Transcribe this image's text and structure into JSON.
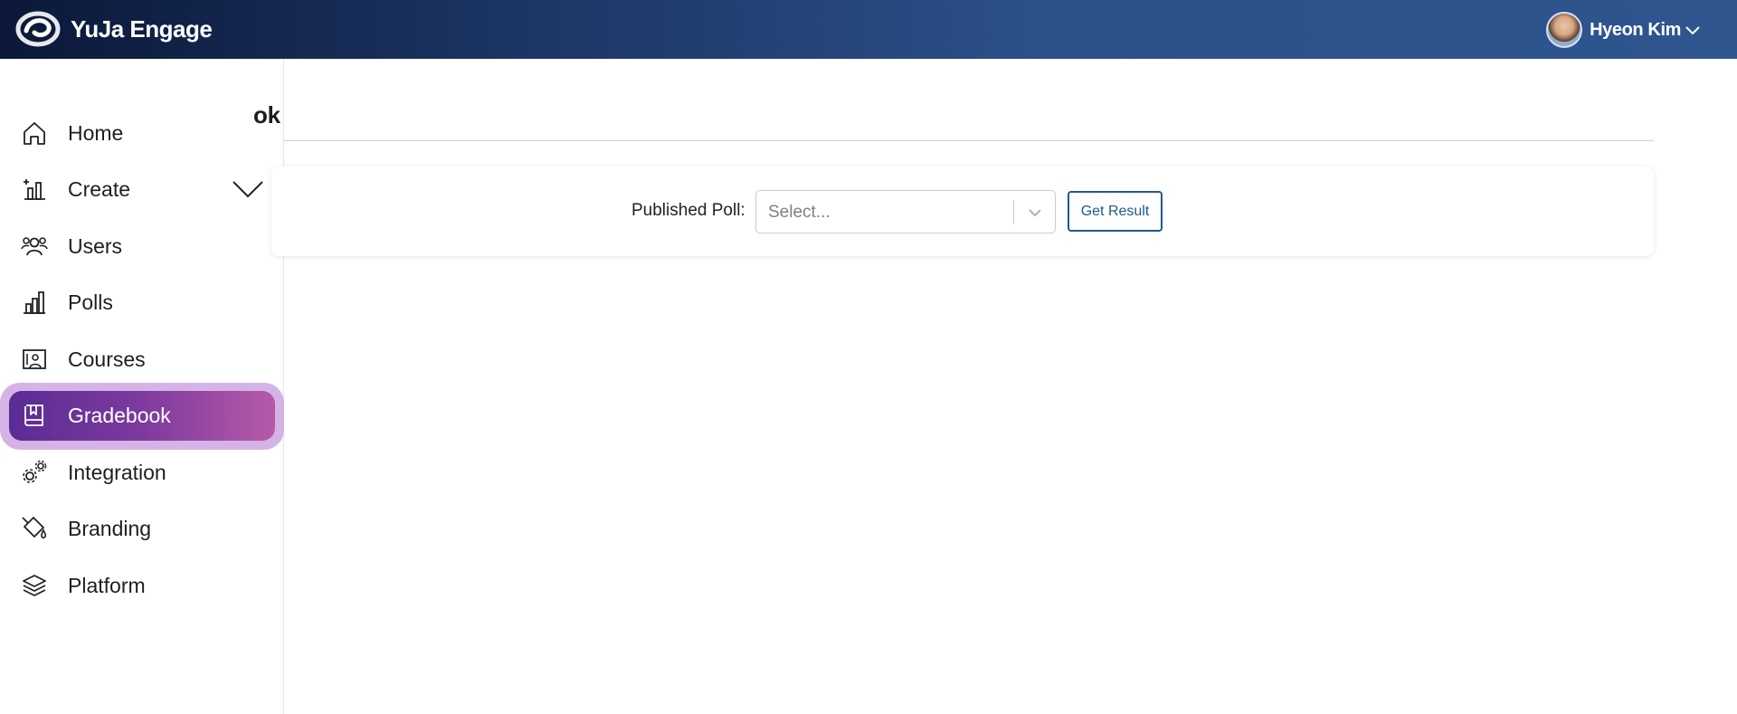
{
  "app": {
    "name": "YuJa Engage",
    "logo_icon": "yuja-logo-icon"
  },
  "user": {
    "name": "Hyeon Kim",
    "menu_icon": "chevron-down-icon"
  },
  "sidebar": {
    "items": [
      {
        "label": "Home",
        "icon": "home-icon"
      },
      {
        "label": "Create",
        "icon": "create-icon",
        "has_submenu": true
      },
      {
        "label": "Users",
        "icon": "users-icon"
      },
      {
        "label": "Polls",
        "icon": "polls-icon"
      },
      {
        "label": "Courses",
        "icon": "courses-icon"
      },
      {
        "label": "Gradebook",
        "icon": "gradebook-icon",
        "active": true
      },
      {
        "label": "Integration",
        "icon": "integration-icon"
      },
      {
        "label": "Branding",
        "icon": "branding-icon"
      },
      {
        "label": "Platform",
        "icon": "platform-icon"
      }
    ],
    "active_color_start": "#5a2c95",
    "active_color_end": "#b65aa8"
  },
  "main": {
    "title_visible": "ok",
    "filter": {
      "label": "Published Poll:",
      "select_placeholder": "Select...",
      "button_label": "Get Result"
    }
  },
  "colors": {
    "header_start": "#0b1838",
    "header_end": "#2f558f",
    "button_accent": "#1f5a8a"
  }
}
